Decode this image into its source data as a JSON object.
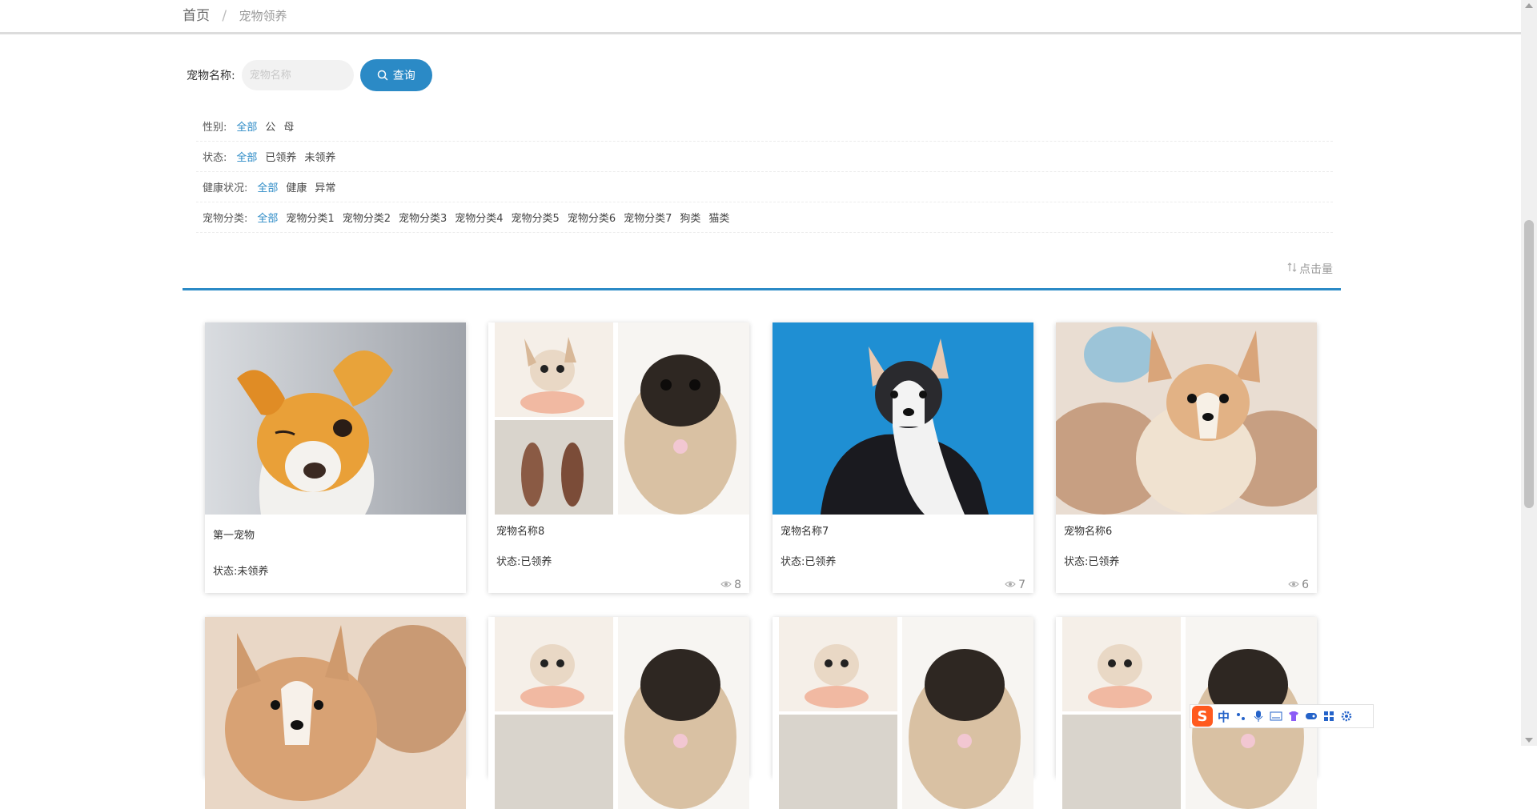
{
  "breadcrumb": {
    "home": "首页",
    "separator": "/",
    "current": "宠物领养"
  },
  "search": {
    "label": "宠物名称:",
    "placeholder": "宠物名称",
    "value": "",
    "button_label": "查询",
    "button_color": "#2b8ac6"
  },
  "filters": [
    {
      "label": "性别:",
      "options": [
        "全部",
        "公",
        "母"
      ],
      "active": 0
    },
    {
      "label": "状态:",
      "options": [
        "全部",
        "已领养",
        "未领养"
      ],
      "active": 0
    },
    {
      "label": "健康状况:",
      "options": [
        "全部",
        "健康",
        "异常"
      ],
      "active": 0
    },
    {
      "label": "宠物分类:",
      "options": [
        "全部",
        "宠物分类1",
        "宠物分类2",
        "宠物分类3",
        "宠物分类4",
        "宠物分类5",
        "宠物分类6",
        "宠物分类7",
        "狗类",
        "猫类"
      ],
      "active": 0
    }
  ],
  "sort": {
    "label": "点击量",
    "icon": "sort-icon"
  },
  "cards": [
    {
      "name": "第一宠物",
      "status": "状态:未领养",
      "views": "",
      "image": "orange-chihuahua-photo"
    },
    {
      "name": "宠物名称8",
      "status": "状态:已领养",
      "views": "8",
      "image": "chihuahua-pug-collage-photo"
    },
    {
      "name": "宠物名称7",
      "status": "状态:已领养",
      "views": "7",
      "image": "corgi-blue-background-photo"
    },
    {
      "name": "宠物名称6",
      "status": "状态:已领养",
      "views": "6",
      "image": "corgi-puppy-photo"
    },
    {
      "name": "",
      "status": "",
      "views": "",
      "image": "corgi-closeup-photo"
    },
    {
      "name": "",
      "status": "",
      "views": "",
      "image": "chihuahua-pug-collage-photo"
    },
    {
      "name": "",
      "status": "",
      "views": "",
      "image": "chihuahua-pug-collage-photo"
    },
    {
      "name": "",
      "status": "",
      "views": "",
      "image": "chihuahua-pug-collage-photo"
    }
  ],
  "ime": {
    "logo": "S",
    "mode": "中"
  },
  "colors": {
    "accent": "#2b8ac6",
    "active_filter": "#2b8ac6"
  }
}
